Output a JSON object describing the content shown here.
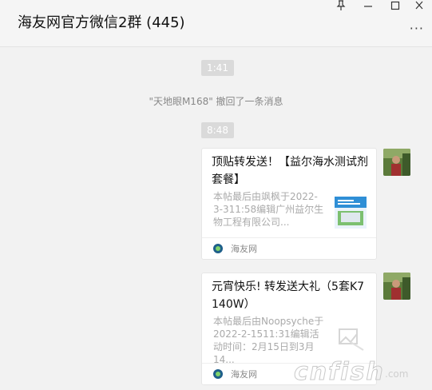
{
  "window": {
    "title": "海友网官方微信2群 (445)",
    "buttons": {
      "pin": "⊥",
      "minimize": "—",
      "maximize": "☐",
      "close": "✕"
    },
    "more": "···"
  },
  "messages": {
    "time1": "1:41",
    "recall_notice": "\"天地眼M168\" 撤回了一条消息",
    "time2": "8:48",
    "cards": [
      {
        "title": "顶贴转发送！【益尔海水测试剂套餐】",
        "desc": "本帖最后由飒枫于2022-3-311:58编辑广州益尔生物工程有限公司...",
        "source": "海友网",
        "thumb_icon": "product-image-icon"
      },
      {
        "title": "元宵快乐! 转发送大礼（5套K7 140W）",
        "desc": "本帖最后由Noopsyche于2022-2-1511:31编辑活动时间：2月15日到3月14...",
        "source": "海友网",
        "thumb_icon": "placeholder-image-icon"
      }
    ]
  },
  "watermark": {
    "main": "cnfish",
    "sub": ".com"
  },
  "colors": {
    "background": "#f2f2f2",
    "card": "#ffffff",
    "time_pill": "#dadada"
  }
}
